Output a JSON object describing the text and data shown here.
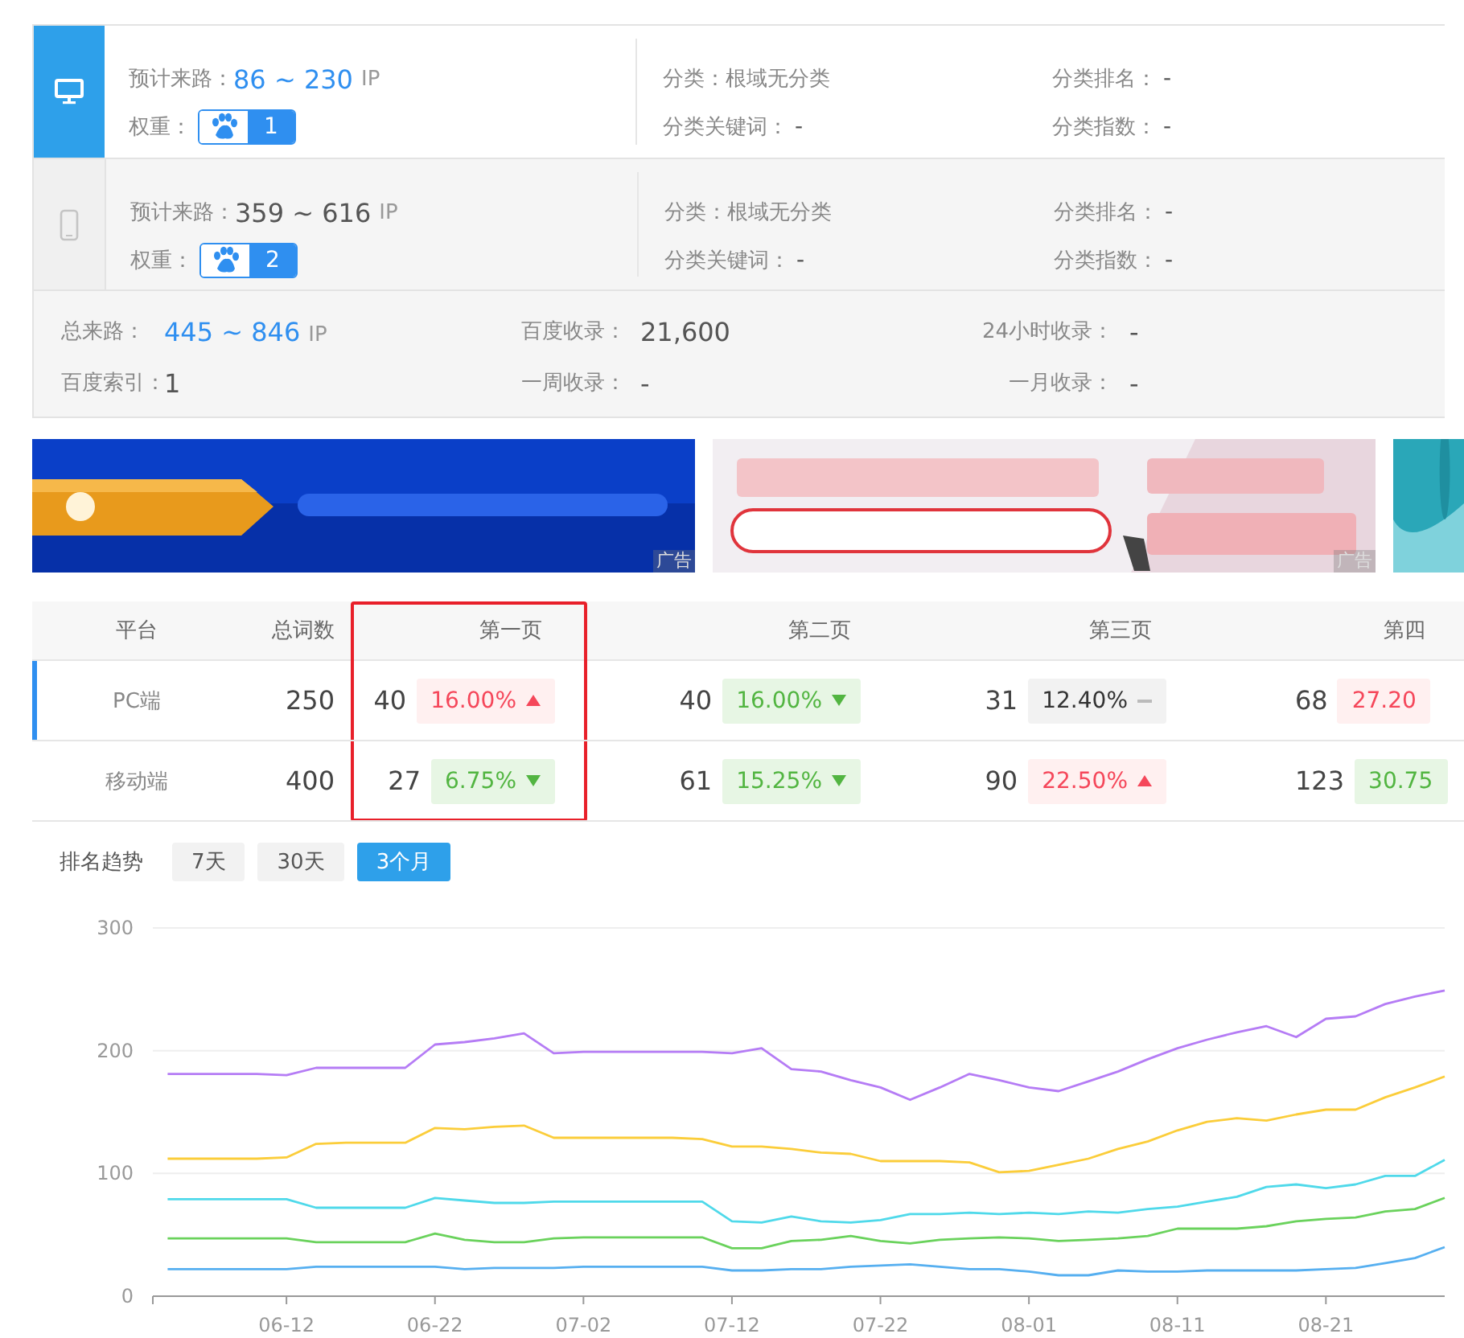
{
  "sources": [
    {
      "kind": "desktop",
      "selected": true,
      "traffic_label": "预计来路：",
      "traffic_value": "86 ~ 230",
      "traffic_unit": "IP",
      "weight_label": "权重：",
      "weight": "1",
      "category": "分类：根域无分类",
      "keyword_label": "分类关键词：",
      "keyword": "-",
      "rank_label": "分类排名：",
      "rank": "-",
      "index_label": "分类指数：",
      "index": "-"
    },
    {
      "kind": "mobile",
      "selected": false,
      "traffic_label": "预计来路：",
      "traffic_value": "359 ~ 616",
      "traffic_unit": "IP",
      "weight_label": "权重：",
      "weight": "2",
      "category": "分类：根域无分类",
      "keyword_label": "分类关键词：",
      "keyword": "-",
      "rank_label": "分类排名：",
      "rank": "-",
      "index_label": "分类指数：",
      "index": "-"
    }
  ],
  "summary": [
    {
      "label": "总来路：",
      "value": "445 ~ 846",
      "unit": "IP",
      "highlight": true
    },
    {
      "label": "百度收录：",
      "value": "21,600",
      "highlight": false
    },
    {
      "label": "24小时收录：",
      "value": "-",
      "highlight": false
    },
    {
      "label": "百度索引：",
      "value": "1",
      "highlight": false
    },
    {
      "label": "一周收录：",
      "value": "-",
      "highlight": false
    },
    {
      "label": "一月收录：",
      "value": "-",
      "highlight": false
    }
  ],
  "ads": [
    {
      "kind": "picture",
      "ad_label": "广告"
    },
    {
      "kind": "picture",
      "ad_label": "广告"
    },
    {
      "kind": "picture"
    }
  ],
  "table": {
    "columns": [
      {
        "label": "平台",
        "highlighted": false
      },
      {
        "label": "总词数",
        "highlighted": false
      },
      {
        "label": "第一页",
        "highlighted": true
      },
      {
        "label": "第二页",
        "highlighted": false
      },
      {
        "label": "第三页",
        "highlighted": false
      },
      {
        "label": "第四",
        "highlighted": false
      }
    ],
    "rows": [
      {
        "platform": "PC端",
        "selected": true,
        "total": "250",
        "pages": [
          {
            "count": "40",
            "percent": "16.00%",
            "kind": "up",
            "arrow": true
          },
          {
            "count": "40",
            "percent": "16.00%",
            "kind": "down",
            "arrow": true
          },
          {
            "count": "31",
            "percent": "12.40%",
            "kind": "flat",
            "arrow": true
          },
          {
            "count": "68",
            "percent": "27.20",
            "kind": "up",
            "arrow": false
          }
        ]
      },
      {
        "platform": "移动端",
        "selected": false,
        "total": "400",
        "pages": [
          {
            "count": "27",
            "percent": "6.75%",
            "kind": "down",
            "arrow": true
          },
          {
            "count": "61",
            "percent": "15.25%",
            "kind": "down",
            "arrow": true
          },
          {
            "count": "90",
            "percent": "22.50%",
            "kind": "up",
            "arrow": true
          },
          {
            "count": "123",
            "percent": "30.75",
            "kind": "down",
            "arrow": false
          }
        ]
      }
    ]
  },
  "trend": {
    "title": "排名趋势",
    "ranges": [
      {
        "label": "7天",
        "selected": false
      },
      {
        "label": "30天",
        "selected": false
      },
      {
        "label": "3个月",
        "selected": true
      }
    ],
    "chart_data": {
      "type": "line",
      "categories": [
        null,
        null,
        null,
        null,
        "06-12",
        null,
        null,
        null,
        null,
        "06-22",
        null,
        null,
        null,
        null,
        "07-02",
        null,
        null,
        null,
        null,
        "07-12",
        null,
        null,
        null,
        null,
        "07-22",
        null,
        null,
        null,
        null,
        "08-01",
        null,
        null,
        null,
        null,
        "08-11",
        null,
        null,
        null,
        null,
        "08-21",
        null,
        null,
        null,
        null
      ],
      "ylim": [
        0,
        300
      ],
      "yticks": [
        0,
        100,
        200,
        300
      ],
      "series": [
        {
          "color": "#b57cf5",
          "values": [
            181,
            181,
            181,
            181,
            180,
            186,
            186,
            186,
            186,
            205,
            207,
            210,
            214,
            198,
            199,
            199,
            199,
            199,
            199,
            198,
            202,
            185,
            183,
            176,
            170,
            160,
            170,
            181,
            176,
            170,
            167,
            175,
            183,
            193,
            202,
            209,
            215,
            220,
            211,
            226,
            228,
            238,
            244,
            249
          ]
        },
        {
          "color": "#fbcd3a",
          "values": [
            112,
            112,
            112,
            112,
            113,
            124,
            125,
            125,
            125,
            137,
            136,
            138,
            139,
            129,
            129,
            129,
            129,
            129,
            128,
            122,
            122,
            120,
            117,
            116,
            110,
            110,
            110,
            109,
            101,
            102,
            107,
            112,
            120,
            126,
            135,
            142,
            145,
            143,
            148,
            152,
            152,
            162,
            170,
            179
          ]
        },
        {
          "color": "#4fd9ea",
          "values": [
            79,
            79,
            79,
            79,
            79,
            72,
            72,
            72,
            72,
            80,
            78,
            76,
            76,
            77,
            77,
            77,
            77,
            77,
            77,
            61,
            60,
            65,
            61,
            60,
            62,
            67,
            67,
            68,
            67,
            68,
            67,
            69,
            68,
            71,
            73,
            77,
            81,
            89,
            91,
            88,
            91,
            98,
            98,
            111
          ]
        },
        {
          "color": "#6ad25c",
          "values": [
            47,
            47,
            47,
            47,
            47,
            44,
            44,
            44,
            44,
            51,
            46,
            44,
            44,
            47,
            48,
            48,
            48,
            48,
            48,
            39,
            39,
            45,
            46,
            49,
            45,
            43,
            46,
            47,
            48,
            47,
            45,
            46,
            47,
            49,
            55,
            55,
            55,
            57,
            61,
            63,
            64,
            69,
            71,
            80
          ]
        },
        {
          "color": "#56aff0",
          "values": [
            22,
            22,
            22,
            22,
            22,
            24,
            24,
            24,
            24,
            24,
            22,
            23,
            23,
            23,
            24,
            24,
            24,
            24,
            24,
            21,
            21,
            22,
            22,
            24,
            25,
            26,
            24,
            22,
            22,
            20,
            17,
            17,
            21,
            20,
            20,
            21,
            21,
            21,
            21,
            22,
            23,
            27,
            31,
            40
          ]
        }
      ]
    }
  }
}
